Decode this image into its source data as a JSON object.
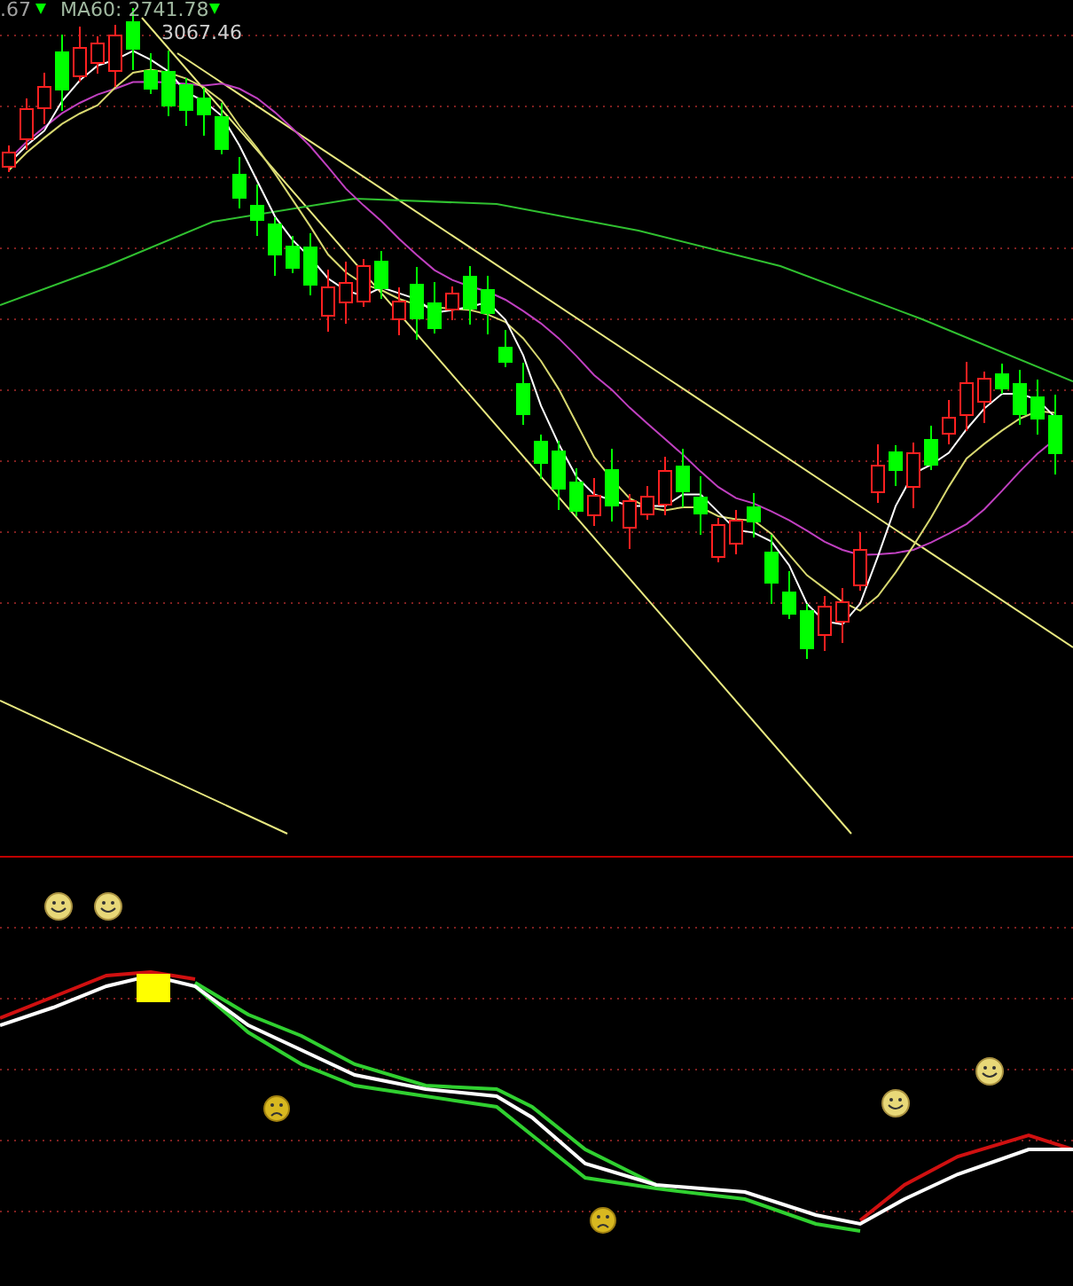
{
  "header": {
    "ma_short": ".67",
    "ma60": "MA60: 2741.78"
  },
  "price_label": "3067.46"
}
